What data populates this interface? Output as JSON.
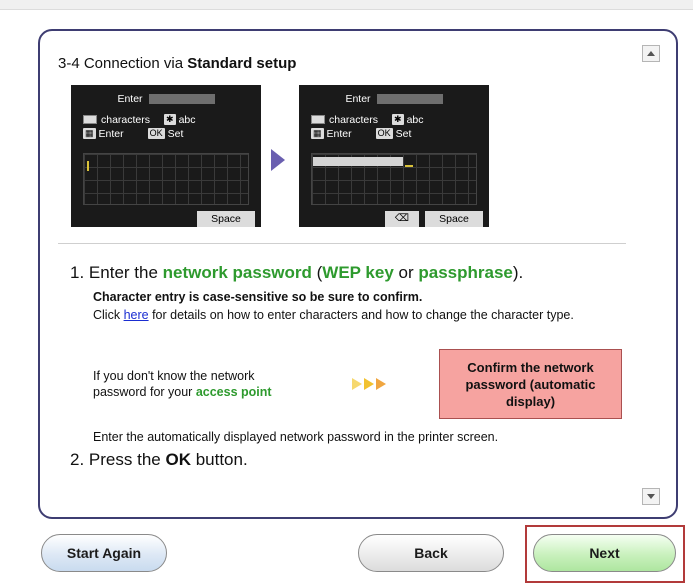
{
  "heading": {
    "prefix": "3-4 Connection via ",
    "bold": "Standard setup"
  },
  "lcd": {
    "title": "Enter",
    "chars_label": "characters",
    "abc_key": "✱",
    "abc_label": "abc",
    "enter_label": "Enter",
    "ok_key": "OK",
    "set_label": "Set",
    "space_label": "Space",
    "backspace_icon": "backspace-icon"
  },
  "step1": {
    "number": "1.",
    "p1": "Enter the ",
    "g1": "network password",
    "p2": " (",
    "g2": "WEP key",
    "p3": " or ",
    "g3": "passphrase",
    "p4": ")."
  },
  "note_bold": "Character entry is case-sensitive so be sure to confirm.",
  "click_pre": "Click ",
  "link": "here",
  "click_post": " for details on how to enter characters and how to change the character type.",
  "dont_know": {
    "text": "If you don't know the network password for your ",
    "ap": "access point"
  },
  "confirm_button": "Confirm the network password (automatic display)",
  "auto_text": "Enter the automatically displayed network password in the printer screen.",
  "step2": {
    "number": "2.",
    "pre": "Press the ",
    "bold": "OK",
    "post": " button."
  },
  "buttons": {
    "start_again": "Start Again",
    "back": "Back",
    "next": "Next"
  },
  "colors": {
    "accent_green": "#2e9a2e",
    "border_blue": "#3e3d72",
    "confirm_bg": "#f6a3a0",
    "highlight_frame": "#b23a3a"
  }
}
